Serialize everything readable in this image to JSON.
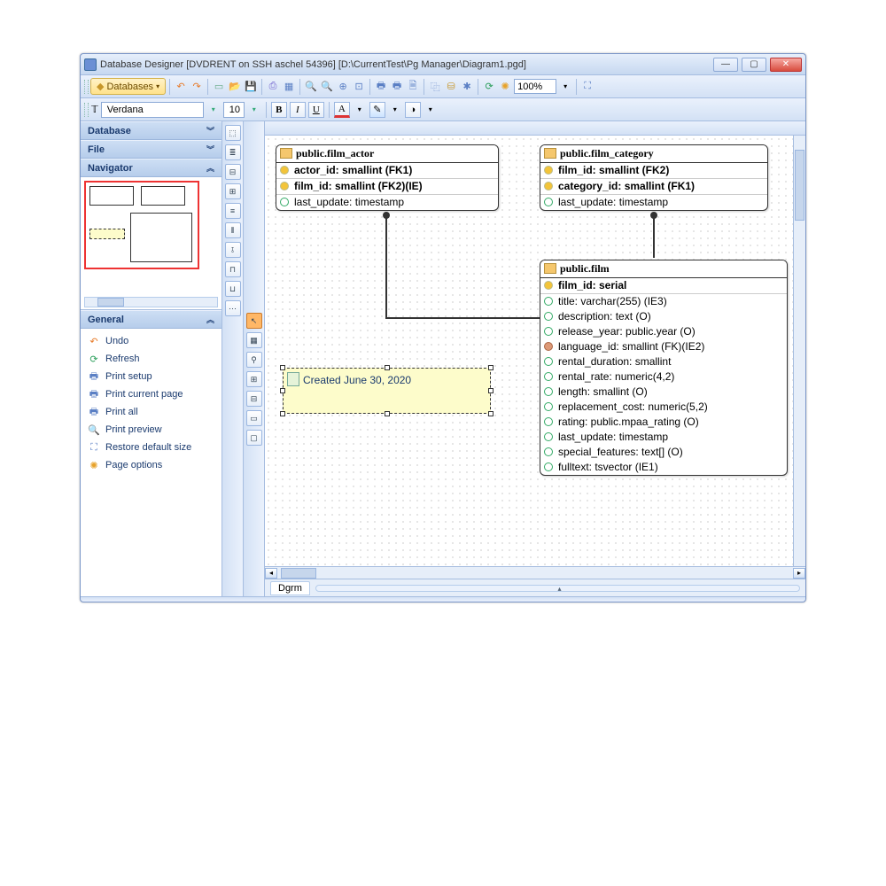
{
  "window": {
    "title": "Database Designer [DVDRENT on SSH aschel 54396] [D:\\CurrentTest\\Pg Manager\\Diagram1.pgd]"
  },
  "toolbar": {
    "databases_label": "Databases",
    "zoom": "100%"
  },
  "font_toolbar": {
    "font_name": "Verdana",
    "font_size": "10",
    "bold": "B",
    "italic": "I",
    "underline": "U",
    "text_color": "A"
  },
  "sidebar": {
    "database": "Database",
    "file": "File",
    "navigator": "Navigator",
    "general": "General",
    "general_items": [
      {
        "icon": "↶",
        "color": "#e77b2a",
        "label": "Undo"
      },
      {
        "icon": "⟳",
        "color": "#2a9e5a",
        "label": "Refresh"
      },
      {
        "icon": "🖶",
        "color": "#5a7fc4",
        "label": "Print setup"
      },
      {
        "icon": "🖶",
        "color": "#5a7fc4",
        "label": "Print current page"
      },
      {
        "icon": "🖶",
        "color": "#5a7fc4",
        "label": "Print all"
      },
      {
        "icon": "🔍",
        "color": "#5a7fc4",
        "label": "Print preview"
      },
      {
        "icon": "⛶",
        "color": "#5a7fc4",
        "label": "Restore default size"
      },
      {
        "icon": "✺",
        "color": "#e7a22a",
        "label": "Page options"
      }
    ]
  },
  "canvas": {
    "tab_label": "Dgrm",
    "note_text": "Created June 30, 2020",
    "tables": {
      "film_actor": {
        "title": "public.film_actor",
        "rows": [
          {
            "t": "k",
            "text": "actor_id: smallint (FK1)"
          },
          {
            "t": "k",
            "text": "film_id: smallint (FK2)(IE)"
          },
          {
            "t": "d",
            "text": "last_update: timestamp"
          }
        ]
      },
      "film_category": {
        "title": "public.film_category",
        "rows": [
          {
            "t": "k",
            "text": "film_id: smallint (FK2)"
          },
          {
            "t": "k",
            "text": "category_id: smallint (FK1)"
          },
          {
            "t": "d",
            "text": "last_update: timestamp"
          }
        ]
      },
      "film": {
        "title": "public.film",
        "rows": [
          {
            "t": "k",
            "text": "film_id: serial"
          },
          {
            "t": "d",
            "text": "title: varchar(255) (IE3)"
          },
          {
            "t": "d",
            "text": "description: text (O)"
          },
          {
            "t": "d",
            "text": "release_year: public.year (O)"
          },
          {
            "t": "f",
            "text": "language_id: smallint (FK)(IE2)"
          },
          {
            "t": "d",
            "text": "rental_duration: smallint"
          },
          {
            "t": "d",
            "text": "rental_rate: numeric(4,2)"
          },
          {
            "t": "d",
            "text": "length: smallint (O)"
          },
          {
            "t": "d",
            "text": "replacement_cost: numeric(5,2)"
          },
          {
            "t": "d",
            "text": "rating: public.mpaa_rating (O)"
          },
          {
            "t": "d",
            "text": "last_update: timestamp"
          },
          {
            "t": "d",
            "text": "special_features: text[] (O)"
          },
          {
            "t": "d",
            "text": "fulltext: tsvector (IE1)"
          }
        ]
      }
    }
  }
}
